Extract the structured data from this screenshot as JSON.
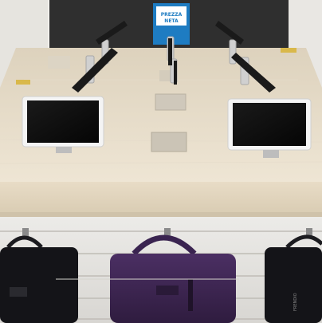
{
  "scene": {
    "kind": "photo",
    "subject": "retail tablet display table with bags hanging below"
  },
  "sign": {
    "line1": "PREZZA",
    "line2": "NETA"
  },
  "bag_label": "FRENDIO",
  "colors": {
    "table_top": "#ece2cf",
    "table_edge": "#e3d6bf",
    "back_wall": "#3a3a3a",
    "slatwall": "#e9e6e1",
    "sign_blue": "#1e7cc2",
    "bag_purple": "#3d2650",
    "bag_black": "#141418"
  }
}
